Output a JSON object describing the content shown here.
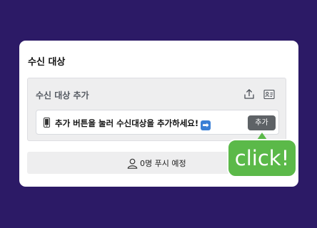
{
  "card": {
    "title": "수신 대상"
  },
  "add_panel": {
    "title": "수신 대상 추가",
    "hint": "추가 버튼을 눌러 수신대상을 추가하세요!",
    "hint_emoji": "➡",
    "add_button_label": "추가"
  },
  "push_status": {
    "text": "0명 푸시 예정"
  },
  "callout": {
    "text": "click!"
  },
  "colors": {
    "background": "#2c1a66",
    "callout_green": "#5bb949",
    "add_button": "#5e6266",
    "hint_arrow": "#3a7fd5"
  },
  "icons": [
    "upload-icon",
    "contact-card-icon",
    "phone-icon",
    "person-icon"
  ]
}
